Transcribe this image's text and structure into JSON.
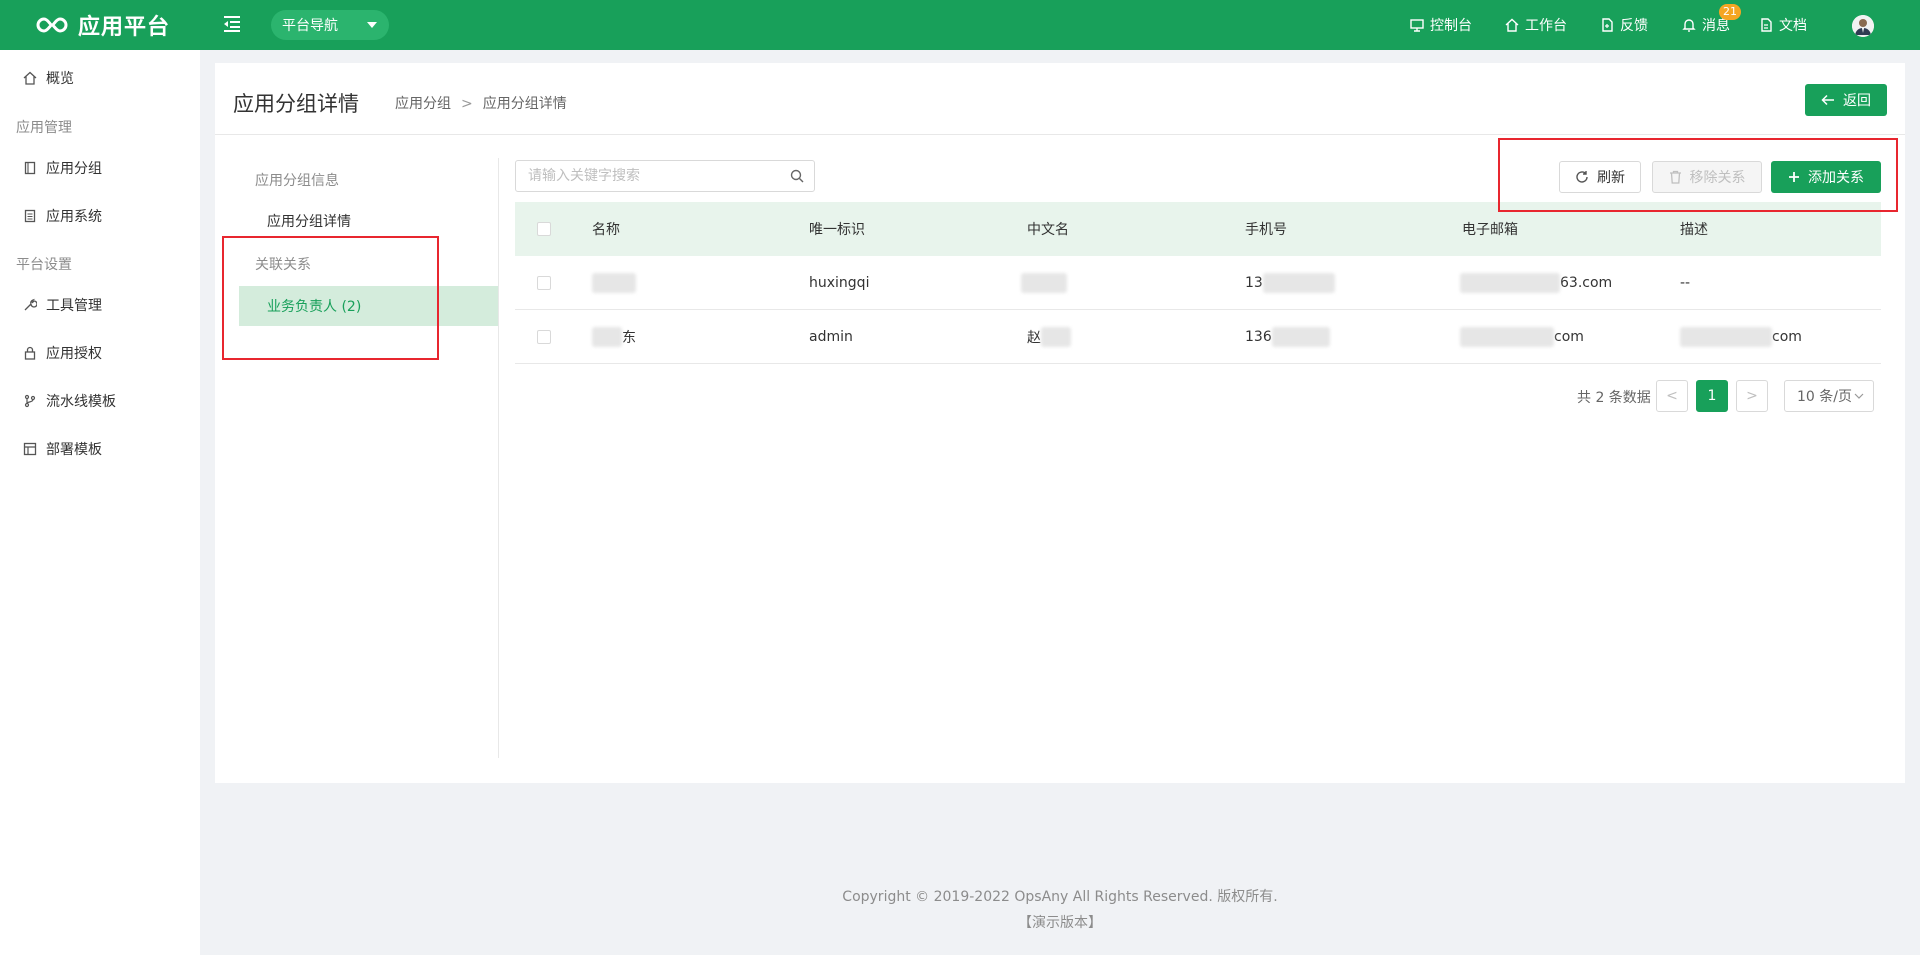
{
  "header": {
    "app_name": "应用平台",
    "nav_dropdown": "平台导航",
    "links": [
      {
        "label": "控制台",
        "icon": "monitor-icon"
      },
      {
        "label": "工作台",
        "icon": "home-icon"
      },
      {
        "label": "反馈",
        "icon": "feedback-icon"
      },
      {
        "label": "消息",
        "icon": "bell-icon"
      },
      {
        "label": "文档",
        "icon": "document-icon"
      }
    ],
    "message_badge": "21"
  },
  "sidebar": {
    "overview": "概览",
    "group_app": "应用管理",
    "app_group": "应用分组",
    "app_system": "应用系统",
    "group_platform": "平台设置",
    "tool_mgmt": "工具管理",
    "app_auth": "应用授权",
    "pipeline_tpl": "流水线模板",
    "deploy_tpl": "部署模板"
  },
  "page": {
    "title": "应用分组详情",
    "breadcrumb": [
      "应用分组",
      ">",
      "应用分组详情"
    ],
    "back_label": "返回"
  },
  "inner_menu": {
    "info_group": "应用分组信息",
    "info_item": "应用分组详情",
    "rel_group": "关联关系",
    "rel_item": "业务负责人 (2)"
  },
  "search": {
    "placeholder": "请输入关键字搜索"
  },
  "actions": {
    "refresh": "刷新",
    "remove": "移除关系",
    "add": "添加关系"
  },
  "table": {
    "columns": [
      "名称",
      "唯一标识",
      "中文名",
      "手机号",
      "电子邮箱",
      "描述"
    ],
    "rows": [
      {
        "name": "",
        "id": "huxingqi",
        "cn": "",
        "phone": "13",
        "email": "63.com",
        "desc": "--"
      },
      {
        "name": "东",
        "id": "admin",
        "cn": "赵",
        "phone": "136",
        "email": "com",
        "desc": "com"
      }
    ]
  },
  "pagination": {
    "total": "共 2 条数据",
    "prev": "<",
    "current": "1",
    "next": ">",
    "page_size": "10 条/页"
  },
  "footer": {
    "copyright": "Copyright © 2019-2022 OpsAny All Rights Reserved. 版权所有.",
    "edition": "【演示版本】"
  },
  "colors": {
    "brand": "#18a05a",
    "annotation": "#e8262f"
  }
}
